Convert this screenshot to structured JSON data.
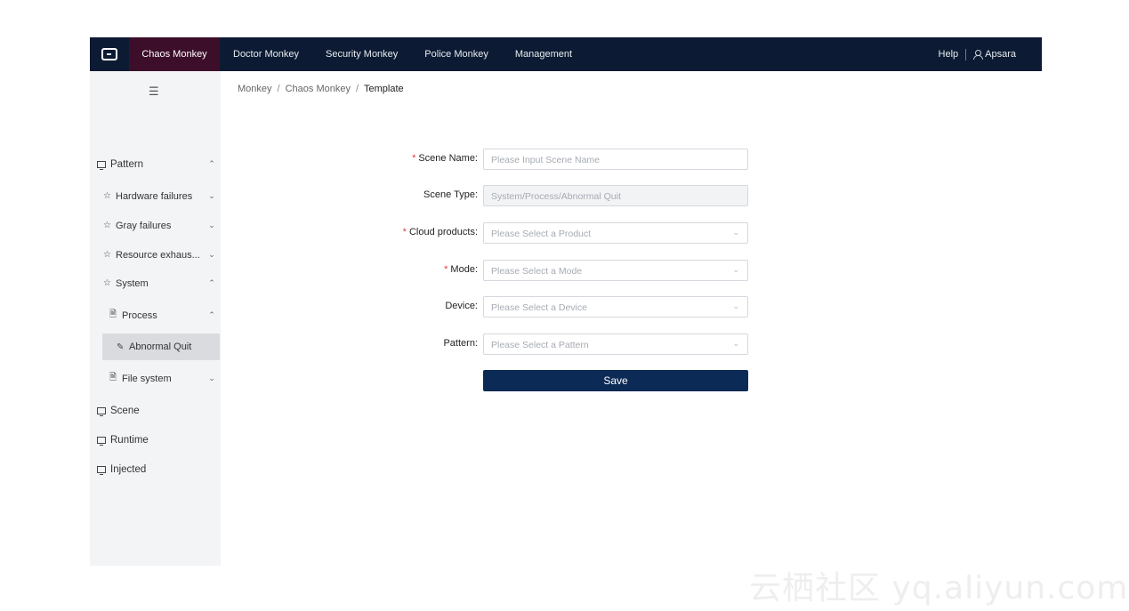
{
  "topbar": {
    "nav": [
      "Chaos Monkey",
      "Doctor Monkey",
      "Security Monkey",
      "Police Monkey",
      "Management"
    ],
    "help": "Help",
    "user": "Apsara"
  },
  "sidebar": {
    "collapse_icon": "menu-fold-icon",
    "items": {
      "pattern": "Pattern",
      "hardware": "Hardware failures",
      "gray": "Gray failures",
      "resource": "Resource exhaus...",
      "system": "System",
      "process": "Process",
      "abnormal": "Abnormal Quit",
      "filesystem": "File system",
      "scene": "Scene",
      "runtime": "Runtime",
      "injected": "Injected"
    }
  },
  "breadcrumb": [
    "Monkey",
    "Chaos Monkey",
    "Template"
  ],
  "form": {
    "scene_name": {
      "label": "Scene Name:",
      "placeholder": "Please Input Scene Name"
    },
    "scene_type": {
      "label": "Scene Type:",
      "value": "System/Process/Abnormal Quit"
    },
    "cloud_products": {
      "label": "Cloud products:",
      "placeholder": "Please Select a Product"
    },
    "mode": {
      "label": "Mode:",
      "placeholder": "Please Select a Mode"
    },
    "device": {
      "label": "Device:",
      "placeholder": "Please Select a Device"
    },
    "pattern": {
      "label": "Pattern:",
      "placeholder": "Please Select a Pattern"
    },
    "save": "Save"
  },
  "watermark": "云栖社区 yq.aliyun.com",
  "colors": {
    "topbar_bg": "#0c1b33",
    "active_nav_bg": "#3d0e2a",
    "save_bg": "#0c2a56",
    "required": "#e4393c"
  }
}
